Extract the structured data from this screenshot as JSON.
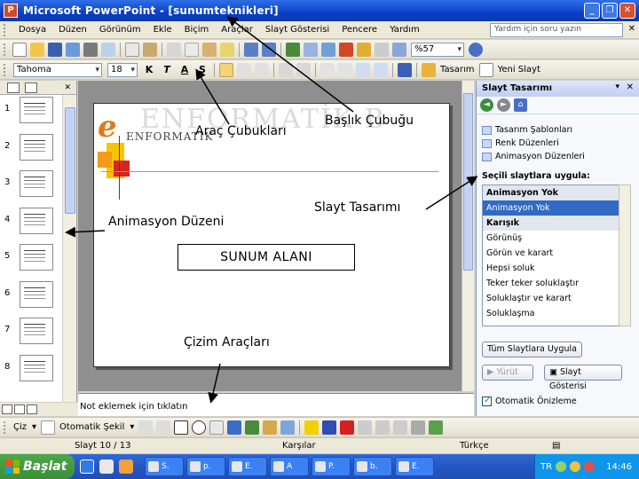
{
  "titlebar": {
    "title": "Microsoft PowerPoint - [sunumteknikleri]",
    "app_icon": "P"
  },
  "menubar": {
    "items": [
      "Dosya",
      "Düzen",
      "Görünüm",
      "Ekle",
      "Biçim",
      "Araçlar",
      "Slayt Gösterisi",
      "Pencere",
      "Yardım"
    ],
    "help_placeholder": "Yardım için soru yazın",
    "close": "✕"
  },
  "toolbar1": {
    "zoom": "%57"
  },
  "toolbar2": {
    "font": "Tahoma",
    "size": "18",
    "bold": "K",
    "italic": "T",
    "underline": "A",
    "shadow": "S",
    "design_label": "Tasarım",
    "new_slide_label": "Yeni Slayt"
  },
  "slide": {
    "logo_letter": "e",
    "logo_text": "ENFORMATİK",
    "logo_ghost": "ENFORMATİK B"
  },
  "annotations": {
    "toolbars": "Araç Çubukları",
    "titlebar": "Başlık Çubuğu",
    "slide_design": "Slayt Tasarımı",
    "animation": "Animasyon Düzeni",
    "presentation_area": "SUNUM ALANI",
    "drawing_tools": "Çizim Araçları"
  },
  "notes": {
    "placeholder": "Not eklemek için tıklatın"
  },
  "outline": {
    "slide_numbers": [
      "1",
      "2",
      "3",
      "4",
      "5",
      "6",
      "7",
      "8"
    ]
  },
  "taskpane": {
    "title": "Slayt Tasarımı",
    "links": [
      "Tasarım Şablonları",
      "Renk Düzenleri",
      "Animasyon Düzenleri"
    ],
    "apply_label": "Seçili slaytlara uygula:",
    "list": [
      {
        "label": "Animasyon Yok",
        "kind": "head"
      },
      {
        "label": "Animasyon Yok",
        "kind": "selected"
      },
      {
        "label": "Karışık",
        "kind": "head"
      },
      {
        "label": "Görünüş",
        "kind": "item"
      },
      {
        "label": "Görün ve karart",
        "kind": "item"
      },
      {
        "label": "Hepsi soluk",
        "kind": "item"
      },
      {
        "label": "Teker teker soluklaştır",
        "kind": "item"
      },
      {
        "label": "Soluklaştır ve karart",
        "kind": "item"
      },
      {
        "label": "Soluklaşma",
        "kind": "item"
      }
    ],
    "apply_all": "Tüm Slaytlara Uygula",
    "play": "Yürüt",
    "slideshow": "Slayt Gösterisi",
    "autopreview": "Otomatik Önizleme"
  },
  "drawbar": {
    "draw": "Çiz",
    "autoshapes": "Otomatik Şekil"
  },
  "statusbar": {
    "slide": "Slayt 10 / 13",
    "design": "Karşılar",
    "language": "Türkçe"
  },
  "taskbar": {
    "start": "Başlat",
    "tasks": [
      "S.",
      "p.",
      "E.",
      "A",
      "P.",
      "b.",
      "E."
    ],
    "lang": "TR",
    "clock": "14:46"
  },
  "colors": {
    "titlebar": "#0a3fc7",
    "accent_orange": "#e07a1a",
    "selection": "#316ac5",
    "taskbar": "#2457c5"
  }
}
